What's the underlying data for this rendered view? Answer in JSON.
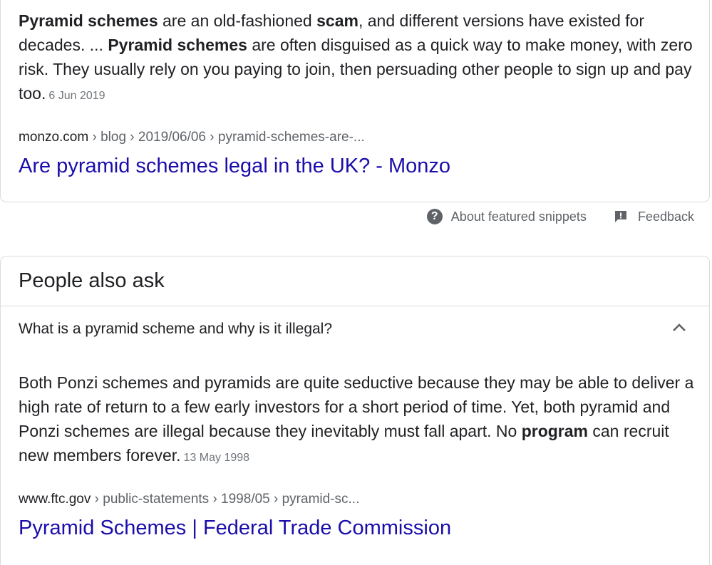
{
  "featured_snippet": {
    "text_segments": [
      {
        "text": "Pyramid schemes",
        "bold": true
      },
      {
        "text": " are an old-fashioned ",
        "bold": false
      },
      {
        "text": "scam",
        "bold": true
      },
      {
        "text": ", and different versions have existed for decades. ... ",
        "bold": false
      },
      {
        "text": "Pyramid schemes",
        "bold": true
      },
      {
        "text": " are often disguised as a quick way to make money, with zero risk. They usually rely on you paying to join, then persuading other people to sign up and pay too.",
        "bold": false
      }
    ],
    "date": "6 Jun 2019",
    "cite_domain": "monzo.com",
    "cite_path": " › blog › 2019/06/06 › pyramid-schemes-are-...",
    "link_title": "Are pyramid schemes legal in the UK? - Monzo"
  },
  "snippet_footer": {
    "about_label": "About featured snippets",
    "feedback_label": "Feedback"
  },
  "people_also_ask": {
    "heading": "People also ask",
    "question": "What is a pyramid scheme and why is it illegal?",
    "answer_segments": [
      {
        "text": "Both Ponzi schemes and pyramids are quite seductive because they may be able to deliver a high rate of return to a few early investors for a short period of time. Yet, both pyramid and Ponzi schemes are illegal because they inevitably must fall apart. No ",
        "bold": false
      },
      {
        "text": "program",
        "bold": true
      },
      {
        "text": " can recruit new members forever.",
        "bold": false
      }
    ],
    "date": "13 May 1998",
    "cite_domain": "www.ftc.gov",
    "cite_path": " › public-statements › 1998/05 › pyramid-sc...",
    "link_title": "Pyramid Schemes | Federal Trade Commission"
  },
  "colors": {
    "link": "#1a0dab",
    "text": "#202124",
    "secondary": "#5f6368",
    "date": "#70757a",
    "border": "#dadce0"
  },
  "icons": {
    "help": "question-circle-icon",
    "feedback": "feedback-flag-icon",
    "chevron": "chevron-up-icon"
  }
}
